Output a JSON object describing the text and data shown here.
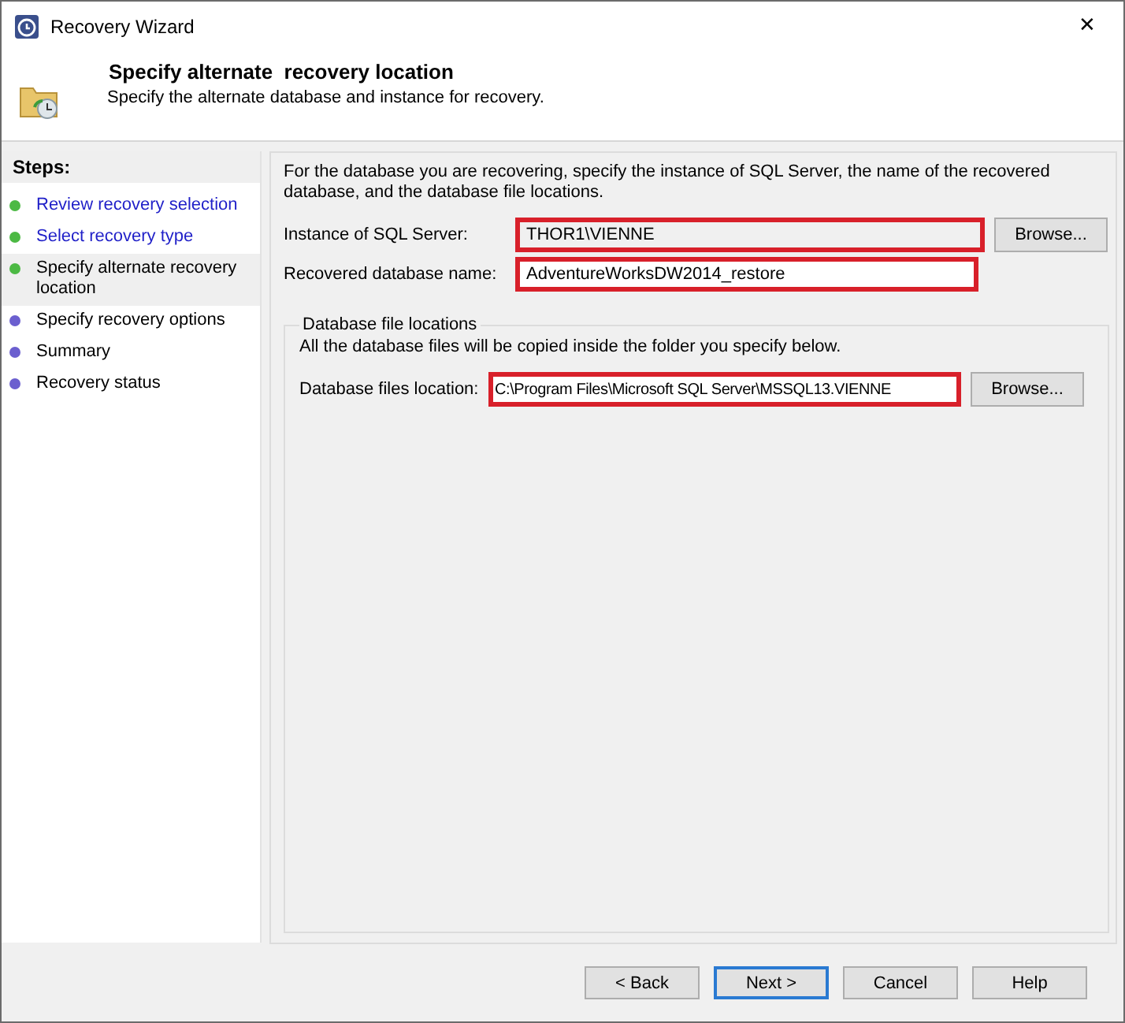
{
  "window": {
    "title": "Recovery Wizard",
    "close": "✕"
  },
  "header": {
    "title": "Specify alternate  recovery location",
    "subtitle": "Specify the alternate database and instance for recovery."
  },
  "steps": {
    "heading": "Steps:",
    "items": [
      {
        "label": "Review recovery selection",
        "completed": true,
        "selected": false
      },
      {
        "label": "Select recovery type",
        "completed": true,
        "selected": false
      },
      {
        "label": "Specify alternate recovery location",
        "completed": true,
        "selected": true
      },
      {
        "label": "Specify recovery options",
        "completed": false,
        "selected": false
      },
      {
        "label": "Summary",
        "completed": false,
        "selected": false
      },
      {
        "label": "Recovery status",
        "completed": false,
        "selected": false
      }
    ]
  },
  "intro": "For the database you are recovering, specify the instance of SQL Server, the name of the recovered database, and the database file locations.",
  "fields": [
    {
      "label": "Instance of SQL Server:",
      "value": "THOR1\\VIENNE",
      "disabled": true,
      "highlighted": true,
      "button": "Browse..."
    },
    {
      "label": "Recovered database name:",
      "value": "AdventureWorksDW2014_restore",
      "disabled": false,
      "highlighted": true
    }
  ],
  "file_locations": {
    "title": "Database file locations",
    "note": "All the database files will be copied inside the folder you specify below.",
    "label": "Database files location:",
    "value": "C:\\Program Files\\Microsoft SQL Server\\MSSQL13.VIENNE",
    "highlighted": true,
    "button": "Browse..."
  },
  "buttons": [
    {
      "label": "< Back",
      "selected": false
    },
    {
      "label": "Next >",
      "selected": true
    },
    {
      "label": "Cancel",
      "selected": false
    },
    {
      "label": "Help",
      "selected": false
    }
  ]
}
